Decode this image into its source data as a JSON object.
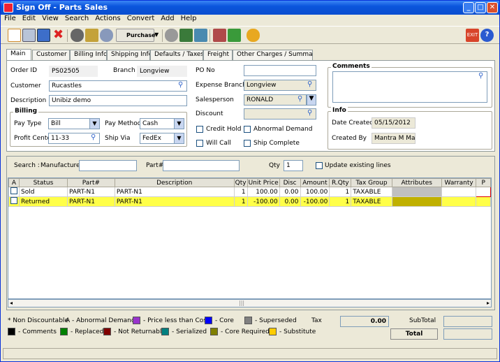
{
  "window": {
    "title": "Sign Off - Parts Sales"
  },
  "menu": [
    "File",
    "Edit",
    "View",
    "Search",
    "Actions",
    "Convert",
    "Add",
    "Help"
  ],
  "toolbar": {
    "purchase_label": "Purchase"
  },
  "tabs": [
    "Main",
    "Customer",
    "Billing Info",
    "Shipping Info",
    "Defaults / Taxes",
    "Freight",
    "Other Charges / Summary"
  ],
  "form": {
    "order_id_label": "Order ID",
    "order_id": "PS02505",
    "branch_label": "Branch",
    "branch": "Longview",
    "customer_label": "Customer",
    "customer": "Rucastles",
    "description_label": "Description",
    "description": "Unibiz demo",
    "billing_title": "Billing",
    "pay_type_label": "Pay Type",
    "pay_type": "Bill",
    "pay_method_label": "Pay Method",
    "pay_method": "Cash",
    "profit_center_label": "Profit Center",
    "profit_center": "11-33",
    "ship_via_label": "Ship Via",
    "ship_via": "FedEx",
    "po_no_label": "PO No",
    "po_no": "",
    "expense_branch_label": "Expense Branch",
    "expense_branch": "Longview",
    "salesperson_label": "Salesperson",
    "salesperson": "RONALD",
    "discount_label": "Discount",
    "discount": "",
    "credit_hold": "Credit Hold",
    "abnormal_demand": "Abnormal Demand",
    "will_call": "Will Call",
    "ship_complete": "Ship Complete",
    "comments_title": "Comments",
    "info_title": "Info",
    "date_created_label": "Date Created",
    "date_created": "05/15/2012",
    "created_by_label": "Created By",
    "created_by": "Mantra M Mantra"
  },
  "search": {
    "label": "Search :",
    "manufacturer_label": "Manufacturer",
    "manufacturer": "",
    "part_label": "Part#",
    "part": "",
    "qty_label": "Qty",
    "qty": "1",
    "update_label": "Update existing lines"
  },
  "grid": {
    "columns": [
      "A",
      "Status",
      "Part#",
      "Description",
      "Qty",
      "Unit Price",
      "Disc",
      "Amount",
      "R.Qty",
      "Tax Group",
      "Attributes",
      "Warranty",
      "P"
    ],
    "rows": [
      {
        "status": "Sold",
        "part": "PART-N1",
        "description": "PART-N1",
        "qty": "1",
        "unit_price": "100.00",
        "disc": "0.00",
        "amount": "100.00",
        "rqty": "1",
        "tax_group": "TAXABLE"
      },
      {
        "status": "Returned",
        "part": "PART-N1",
        "description": "PART-N1",
        "qty": "1",
        "unit_price": "-100.00",
        "disc": "0.00",
        "amount": "-100.00",
        "rqty": "1",
        "tax_group": "TAXABLE"
      }
    ],
    "scroll_mark": "|||"
  },
  "legend": {
    "non_discountable": "* Non Discountable",
    "abnormal": "A - Abnormal Demand",
    "items": [
      {
        "label": "- Price less than Cost",
        "color": "#9933cc"
      },
      {
        "label": "- Core",
        "color": "#0000ff"
      },
      {
        "label": "- Superseded",
        "color": "#808080"
      },
      {
        "label": "- Comments",
        "color": "#000000"
      },
      {
        "label": "- Replaced",
        "color": "#008000"
      },
      {
        "label": "- Not Returnable",
        "color": "#800000"
      },
      {
        "label": "- Serialized",
        "color": "#008080"
      },
      {
        "label": "- Core Required",
        "color": "#808000"
      },
      {
        "label": "- Substitute",
        "color": "#ffcc00"
      }
    ]
  },
  "totals": {
    "tax_label": "Tax",
    "tax": "0.00",
    "subtotal_label": "SubTotal",
    "subtotal": "",
    "total_label": "Total",
    "total": ""
  }
}
